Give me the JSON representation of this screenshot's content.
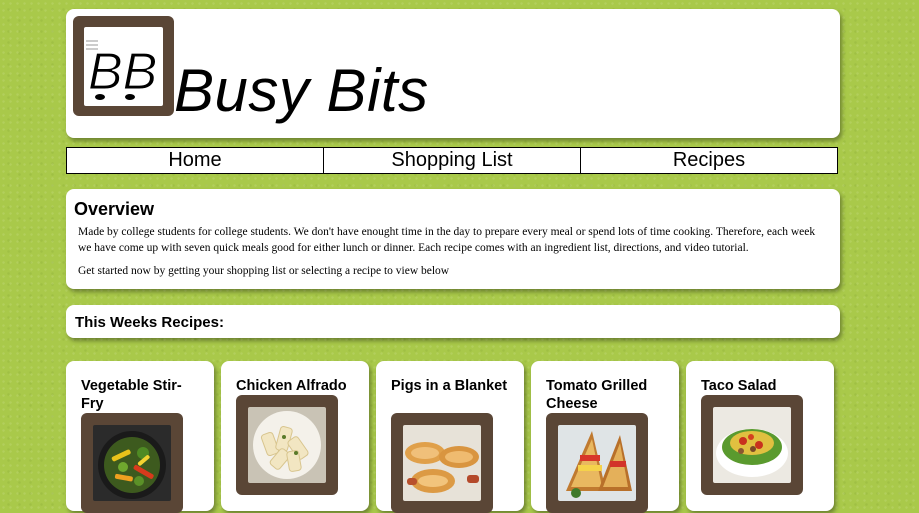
{
  "site": {
    "title": "Busy Bits",
    "logo_text": "BB"
  },
  "nav": [
    "Home",
    "Shopping List",
    "Recipes"
  ],
  "overview": {
    "title": "Overview",
    "p1": "Made by college students for college students. We don't have enought time in the day to prepare every meal or spend lots of time cooking. Therefore, each week we have come up with seven quick meals good for either lunch or dinner. Each recipe comes with an ingredient list, directions, and video tutorial.",
    "p2": "Get started now by getting your shopping list or selecting a recipe to view below"
  },
  "recipes": {
    "title": "This Weeks Recipes:",
    "items": [
      {
        "name": "Vegetable Stir-Fry",
        "image": "stir-fry-photo"
      },
      {
        "name": "Chicken Alfrado",
        "image": "pasta-photo"
      },
      {
        "name": "Pigs in a Blanket",
        "image": "pigs-in-blanket-photo"
      },
      {
        "name": "Tomato Grilled Cheese",
        "image": "grilled-cheese-photo"
      },
      {
        "name": "Taco Salad",
        "image": "taco-salad-photo"
      }
    ]
  },
  "colors": {
    "background": "#a9c94a",
    "frame": "#5a4636",
    "panel": "#ffffff"
  }
}
